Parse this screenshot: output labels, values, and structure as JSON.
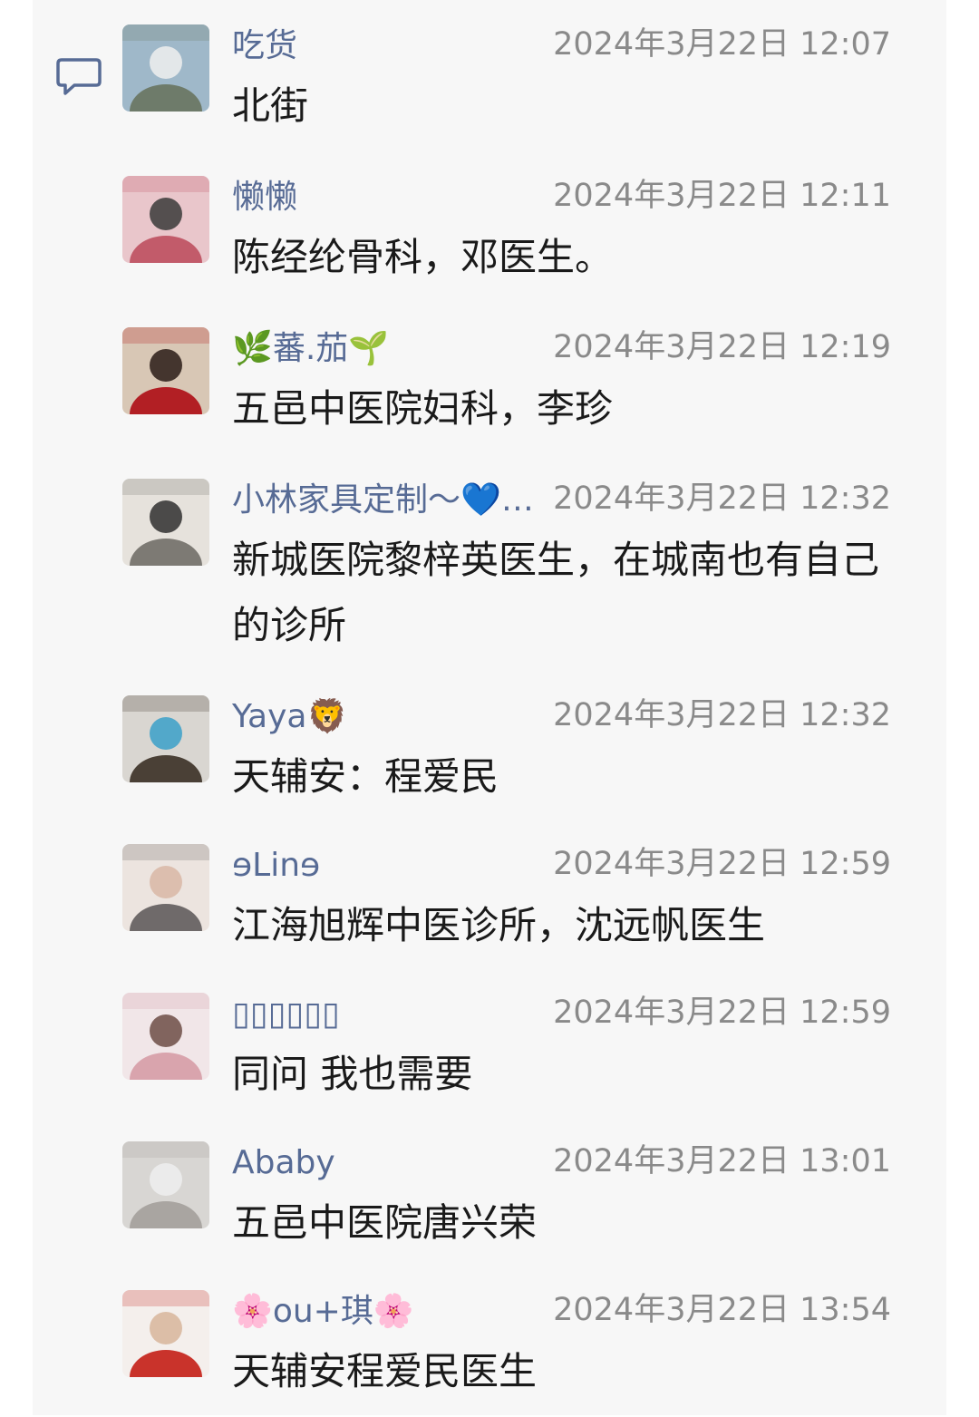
{
  "comments": [
    {
      "name": "吃货",
      "time": "2024年3月22日 12:07",
      "text": "北街",
      "avatar_colors": [
        "#9fb8c9",
        "#6e7b6a",
        "#efefef"
      ]
    },
    {
      "name": "懒懒",
      "time": "2024年3月22日 12:11",
      "text": "陈经纶骨科，邓医生。",
      "avatar_colors": [
        "#e9c6cb",
        "#c25b6a",
        "#3a3a3a"
      ]
    },
    {
      "name": "🌿蕃.茄🌱",
      "time": "2024年3月22日 12:19",
      "text": "五邑中医院妇科，李珍",
      "avatar_colors": [
        "#d8c7b5",
        "#b21f24",
        "#2a1b16"
      ]
    },
    {
      "name": "小林家具定制～💙…",
      "time": "2024年3月22日 12:32",
      "text": "新城医院黎梓英医生，在城南也有自己的诊所",
      "avatar_colors": [
        "#e6e2dc",
        "#7d7a74",
        "#2f2f2f"
      ]
    },
    {
      "name": "Yaya🦁",
      "time": "2024年3月22日 12:32",
      "text": "天辅安：程爱民",
      "avatar_colors": [
        "#d9d6d1",
        "#4a4036",
        "#3aa0c9"
      ]
    },
    {
      "name": "ɘLinɘ",
      "time": "2024年3月22日 12:59",
      "text": "江海旭辉中医诊所，沈远帆医生",
      "avatar_colors": [
        "#ece4df",
        "#6f6a6a",
        "#d9b7a6"
      ]
    },
    {
      "name": "▯▯▯▯▯▯",
      "time": "2024年3月22日 12:59",
      "text": "同问 我也需要",
      "avatar_colors": [
        "#f1e6e8",
        "#d9a4ad",
        "#6d4c45"
      ]
    },
    {
      "name": "Ababy",
      "time": "2024年3月22日 13:01",
      "text": "五邑中医院唐兴荣",
      "avatar_colors": [
        "#d8d6d3",
        "#a9a5a1",
        "#eeeeee"
      ]
    },
    {
      "name": "🌸ou+琪🌸",
      "time": "2024年3月22日 13:54",
      "text": "天辅安程爱民医生",
      "avatar_colors": [
        "#f4efec",
        "#c9332b",
        "#d7b59b"
      ]
    }
  ]
}
